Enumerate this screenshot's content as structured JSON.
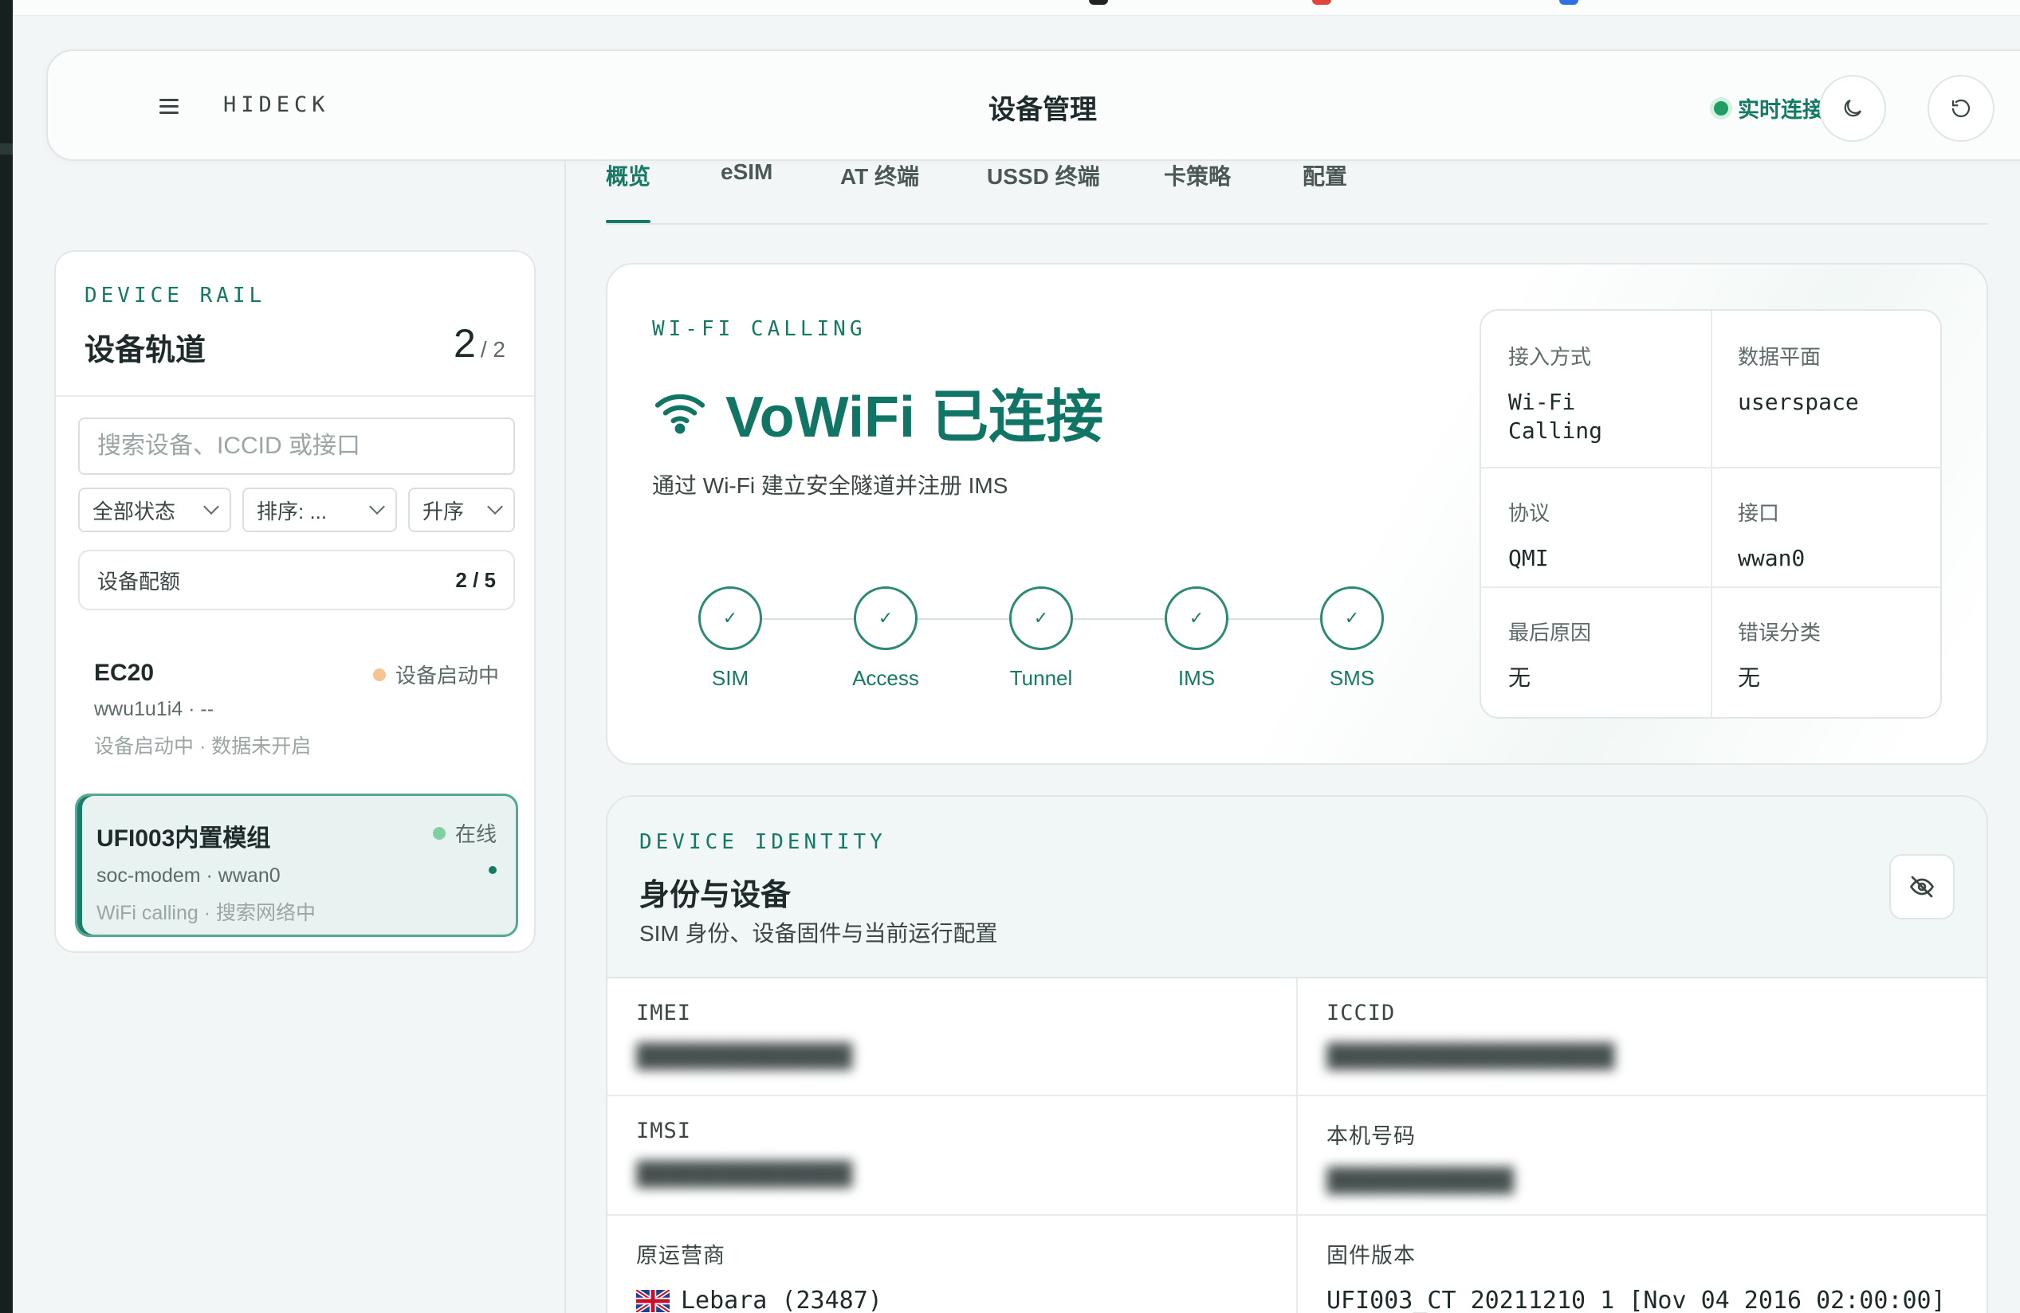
{
  "header": {
    "brand": "HIDECK",
    "title": "设备管理",
    "live_status": "实时连接",
    "theme_icon": "moon-icon",
    "refresh_icon": "refresh-icon"
  },
  "sidebar": {
    "eyebrow": "DEVICE RAIL",
    "title": "设备轨道",
    "count_current": "2",
    "count_total": "/ 2",
    "search_placeholder": "搜索设备、ICCID 或接口",
    "filters": [
      {
        "label": "全部状态"
      },
      {
        "label": "排序: ..."
      },
      {
        "label": "升序"
      }
    ],
    "quota_label": "设备配额",
    "quota_value": "2 / 5",
    "devices": [
      {
        "name": "EC20",
        "sub": "wwu1u1i4 · --",
        "note": "设备启动中 · 数据未开启",
        "status": "设备启动中",
        "status_color": "#f6c491"
      },
      {
        "name": "UFI003内置模组",
        "sub": "soc-modem · wwan0",
        "note": "WiFi calling · 搜索网络中",
        "status": "在线",
        "status_color": "#7fd1a0"
      }
    ]
  },
  "tabs": [
    {
      "label": "概览"
    },
    {
      "label": "eSIM"
    },
    {
      "label": "AT 终端"
    },
    {
      "label": "USSD 终端"
    },
    {
      "label": "卡策略"
    },
    {
      "label": "配置"
    }
  ],
  "wifi_calling": {
    "eyebrow": "WI-FI CALLING",
    "headline": "VoWiFi 已连接",
    "description": "通过 Wi-Fi 建立安全隧道并注册 IMS",
    "steps": [
      {
        "label": "SIM"
      },
      {
        "label": "Access"
      },
      {
        "label": "Tunnel"
      },
      {
        "label": "IMS"
      },
      {
        "label": "SMS"
      }
    ],
    "info": {
      "access_label": "接入方式",
      "access_value": "Wi-Fi Calling",
      "plane_label": "数据平面",
      "plane_value": "userspace",
      "protocol_label": "协议",
      "protocol_value": "QMI",
      "iface_label": "接口",
      "iface_value": "wwan0",
      "reason_label": "最后原因",
      "reason_value": "无",
      "error_label": "错误分类",
      "error_value": "无"
    }
  },
  "identity": {
    "eyebrow": "DEVICE IDENTITY",
    "title": "身份与设备",
    "description": "SIM 身份、设备固件与当前运行配置",
    "fields": {
      "imei_label": "IMEI",
      "imei_value": "",
      "iccid_label": "ICCID",
      "iccid_value": "",
      "imsi_label": "IMSI",
      "imsi_value": "",
      "msisdn_label": "本机号码",
      "msisdn_value": "",
      "carrier_label": "原运营商",
      "carrier_value": "Lebara (23487)",
      "firmware_label": "固件版本",
      "firmware_value": "UFI003_CT 20211210 1 [Nov 04 2016 02:00:00]"
    }
  },
  "colors": {
    "accent": "#147a64",
    "online": "#7fd1a0",
    "booting": "#f6c491",
    "live": "#1e9e64"
  }
}
